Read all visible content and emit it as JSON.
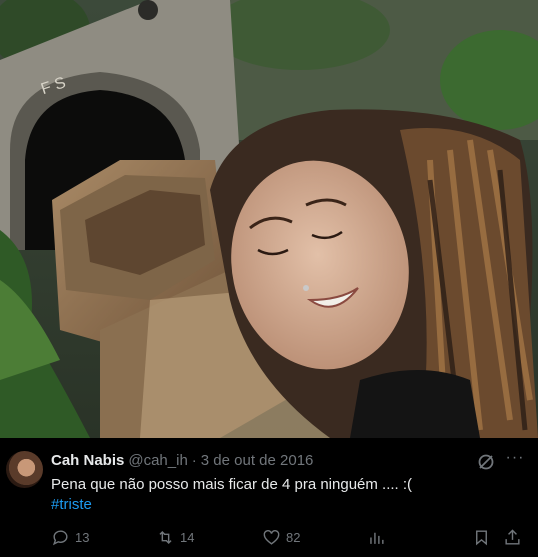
{
  "photo": {
    "description_icon": "tweet-photo",
    "tunnel_marking": "F S"
  },
  "tweet": {
    "display_name": "Cah Nabis",
    "handle": "@cah_ih",
    "separator": "·",
    "date": "3 de out de 2016",
    "text": "Pena que não posso mais ficar de 4 pra ninguém .... :(",
    "hashtag": "#triste",
    "more_label": "···"
  },
  "actions": {
    "replies": "13",
    "retweets": "14",
    "likes": "82"
  },
  "colors": {
    "background": "#000000",
    "text": "#e7e9ea",
    "muted": "#71767b",
    "link": "#1d9bf0"
  },
  "icons": [
    "grok-icon",
    "more-icon",
    "reply-icon",
    "retweet-icon",
    "like-icon",
    "views-icon",
    "bookmark-icon",
    "share-icon"
  ]
}
